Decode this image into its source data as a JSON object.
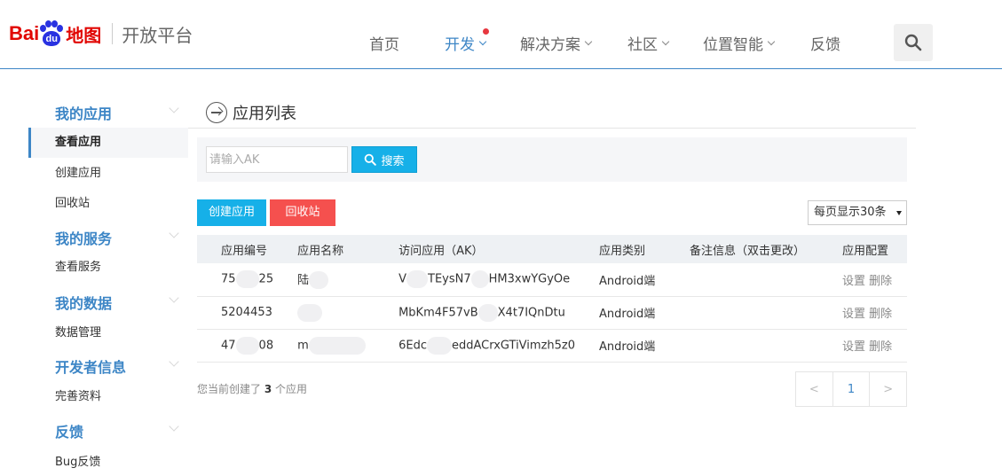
{
  "logo": {
    "bai": "Bai",
    "du": "du",
    "map": "地图",
    "title": "开放平台"
  },
  "nav": {
    "home": "首页",
    "develop": "开发",
    "solutions": "解决方案",
    "community": "社区",
    "location_ai": "位置智能",
    "feedback": "反馈",
    "search_icon": "search-icon",
    "accent_color": "#3d86c6",
    "dot_color": "#e7373f"
  },
  "sidebar": {
    "groups": [
      {
        "title": "我的应用",
        "items": [
          "查看应用",
          "创建应用",
          "回收站"
        ]
      },
      {
        "title": "我的服务",
        "items": [
          "查看服务"
        ]
      },
      {
        "title": "我的数据",
        "items": [
          "数据管理"
        ]
      },
      {
        "title": "开发者信息",
        "items": [
          "完善资料"
        ]
      },
      {
        "title": "反馈",
        "items": [
          "Bug反馈"
        ]
      }
    ],
    "active_item": "查看应用"
  },
  "main": {
    "page_title": "应用列表",
    "search": {
      "placeholder": "请输入AK",
      "button_label": "搜索"
    },
    "create_button": "创建应用",
    "recycle_button": "回收站",
    "per_page": "每页显示30条",
    "table": {
      "headers": [
        "应用编号",
        "应用名称",
        "访问应用（AK）",
        "应用类别",
        "备注信息（双击更改）",
        "应用配置"
      ],
      "rows": [
        {
          "id": "75",
          "id_tail": "25",
          "name": "陆",
          "ak": "V",
          "ak_tail": "TEysN7",
          "ak_tail2": "HM3xwYGyOe",
          "type": "Android端",
          "note": "",
          "settings": "设置",
          "delete": "删除"
        },
        {
          "id": "5204453",
          "id_tail": "",
          "name": "",
          "ak": "MbKm4F57vB",
          "ak_tail": "",
          "ak_tail2": "X4t7IQnDtu",
          "type": "Android端",
          "note": "",
          "settings": "设置",
          "delete": "删除"
        },
        {
          "id": "47",
          "id_tail": "08",
          "name": "m",
          "ak": "6Edc",
          "ak_tail": "",
          "ak_tail2": "eddACrxGTiVimzh5z0",
          "type": "Android端",
          "note": "",
          "settings": "设置",
          "delete": "删除"
        }
      ]
    },
    "footer": {
      "prefix": "您当前创建了",
      "count": "3",
      "suffix": "个应用"
    },
    "pager": {
      "prev": "<",
      "page": "1",
      "next": ">"
    }
  }
}
